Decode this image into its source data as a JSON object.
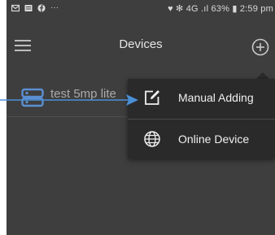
{
  "status_bar": {
    "left_icons": [
      "mail-icon",
      "message-icon",
      "facebook-icon"
    ],
    "overflow": "···",
    "right_text": "♥ ✻ 4G .ıl 63% ▮ 2:59 pm"
  },
  "header": {
    "title": "Devices",
    "menu_icon": "hamburger-icon",
    "add_icon": "plus-circle-icon"
  },
  "devices": [
    {
      "name": "test 5mp lite",
      "icon": "camera-server-icon"
    }
  ],
  "dropdown": {
    "items": [
      {
        "label": "Manual Adding",
        "icon": "edit-icon"
      },
      {
        "label": "Online Device",
        "icon": "globe-icon"
      }
    ]
  },
  "colors": {
    "background": "#3e3e3e",
    "menu_background": "#2a2a2a",
    "accent": "#4a8fd6"
  }
}
